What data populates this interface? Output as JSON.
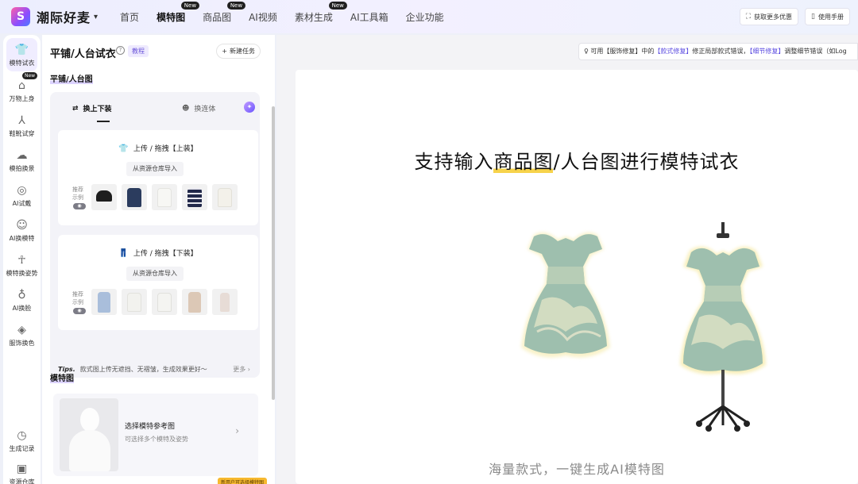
{
  "header": {
    "brand": "潮际好麦",
    "logo_glyph": "S",
    "nav": [
      {
        "label": "首页",
        "badge": ""
      },
      {
        "label": "模特图",
        "badge": "New",
        "active": true
      },
      {
        "label": "商品图",
        "badge": "New"
      },
      {
        "label": "AI视频",
        "badge": ""
      },
      {
        "label": "素材生成",
        "badge": "New"
      },
      {
        "label": "AI工具箱",
        "badge": ""
      },
      {
        "label": "企业功能",
        "badge": ""
      }
    ],
    "right_buttons": [
      "获取更多优惠",
      "使用手册"
    ]
  },
  "iconbar": {
    "items": [
      {
        "label": "模特试衣",
        "icon": "shirt-icon",
        "active": true
      },
      {
        "label": "万物上身",
        "icon": "hanger-icon",
        "badge": "New"
      },
      {
        "label": "鞋靴试穿",
        "icon": "shoe-icon"
      },
      {
        "label": "模拍换景",
        "icon": "scene-icon"
      },
      {
        "label": "AI试戴",
        "icon": "ring-icon"
      },
      {
        "label": "AI换模特",
        "icon": "person-icon"
      },
      {
        "label": "模特换姿势",
        "icon": "pose-icon"
      },
      {
        "label": "AI换脸",
        "icon": "face-icon"
      },
      {
        "label": "服饰换色",
        "icon": "paint-bucket-icon"
      },
      {
        "label": "生成记录",
        "icon": "clock-icon"
      },
      {
        "label": "资源仓库",
        "icon": "folder-icon"
      }
    ]
  },
  "panel": {
    "title": "平铺/人台试衣",
    "tutorial_tag": "教程",
    "new_task": "新建任务",
    "section1": "平铺/人台图",
    "tabs": [
      "换上下装",
      "换连体"
    ],
    "top_card": {
      "title": "上传 / 拖拽【上装】",
      "import": "从资源仓库导入",
      "rec_label": "推荐示例"
    },
    "bottom_card": {
      "title": "上传 / 拖拽【下装】",
      "import": "从资源仓库导入",
      "rec_label": "推荐示例"
    },
    "tips_label": "Tips.",
    "tips_text": "款式图上传无遮挡、无褶皱，生成效果更好～",
    "tips_more": "更多",
    "section2": "模特图",
    "model_title": "选择模特参考图",
    "model_sub": "可选择多个模特及姿势",
    "bottom_tag": "新用户可选择模特图"
  },
  "main": {
    "notice_pre": "可用【服饰修复】中的",
    "notice_link1": "【款式修复】",
    "notice_mid": "修正局部款式错误，",
    "notice_link2": "【细节修复】",
    "notice_post": "调整细节错误（如Log",
    "headline_a": "支持输入",
    "headline_b": "商品图",
    "headline_c": "/人台图进行模特试衣",
    "subline": "海量款式，一键生成AI模特图"
  },
  "colors": {
    "accent": "#7b5cff",
    "dress_main": "#9ebfae",
    "dress_light": "#dfe3c6"
  }
}
